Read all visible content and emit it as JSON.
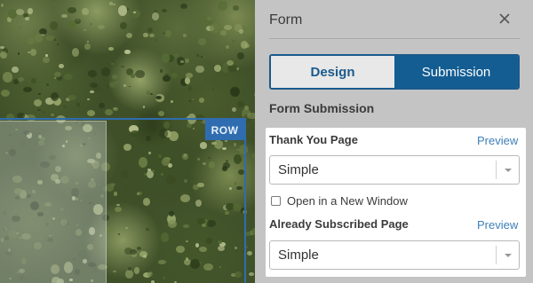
{
  "canvas": {
    "row_badge": "ROW"
  },
  "panel": {
    "title": "Form",
    "close_icon": "close-icon",
    "tabs": [
      {
        "label": "Design",
        "active": false
      },
      {
        "label": "Submission",
        "active": true
      }
    ],
    "section_title": "Form Submission",
    "thank_you": {
      "label": "Thank You Page",
      "preview": "Preview",
      "selected": "Simple"
    },
    "open_new_window": {
      "label": "Open in a New Window",
      "checked": false
    },
    "already_subscribed": {
      "label": "Already Subscribed Page",
      "preview": "Preview",
      "selected": "Simple"
    }
  },
  "colors": {
    "accent": "#135d92",
    "link": "#3d7fb8",
    "row_outline": "#2f6db0",
    "panel_bg": "#c4c4c4"
  }
}
